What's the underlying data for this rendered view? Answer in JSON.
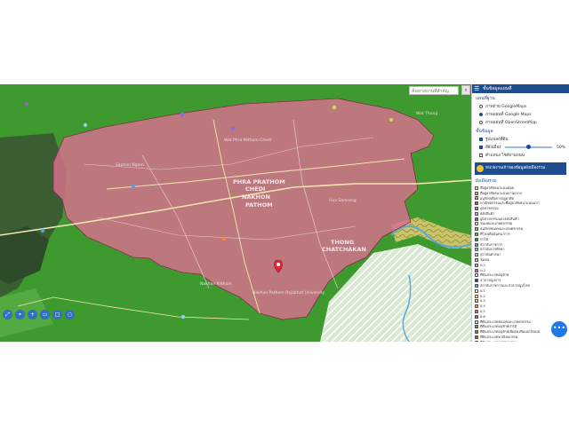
{
  "search": {
    "placeholder": "ค้นหาสถานที่สำคัญ",
    "button_icon": "search-icon"
  },
  "panel": {
    "header": "ชั้นข้อมูลแผนที่",
    "basemap_title": "แผนที่ฐาน",
    "basemaps": [
      {
        "label": "ภาพถ่าย GoogleMaps",
        "selected": false
      },
      {
        "label": "ภาพแผนที่ Google Maps",
        "selected": true
      },
      {
        "label": "ภาพแผนที่ OpenStreetMap",
        "selected": false
      }
    ],
    "layers_title": "ชั้นข้อมูล",
    "layers": [
      {
        "label": "รูปแปลงที่ดิน",
        "checked": true
      },
      {
        "label": "สีผังเมือง",
        "checked": true,
        "opacity_label": "50%",
        "opacity": 0.5
      },
      {
        "label": "ตำแหน่ง ไซท์งานถนน",
        "checked": false
      }
    ],
    "agency": "หน่วยงานเจ้าของข้อมูลผังเมืองรวม",
    "legend_title": "ผังเมืองรวม",
    "legend": [
      {
        "label": "ที่อยู่อาศัยหนาแน่นน้อย",
        "color": "#f7e35a"
      },
      {
        "label": "ที่อยู่อาศัยหนาแน่นปานกลาง",
        "color": "#f2a23a"
      },
      {
        "label": "อนุรักษ์เพื่อการอยู่อาศัย",
        "color": "#c8a06a"
      },
      {
        "label": "พาณิชยกรรมและที่อยู่อาศัยหนาแน่นมาก",
        "color": "#e8324a"
      },
      {
        "label": "อุตสาหกรรม",
        "color": "#b06ad8"
      },
      {
        "label": "คลังสินค้า",
        "color": "#d3a6e8"
      },
      {
        "label": "อุตสาหกรรมและคลังสินค้า",
        "color": "#9b4fb8"
      },
      {
        "label": "ชนบทและเกษตรกรรม",
        "color": "#e7f1c8"
      },
      {
        "label": "อนุรักษ์ชนบทและเกษตรกรรม",
        "color": "#7ec46b"
      },
      {
        "label": "ที่โล่งเพื่อนันทนาการ",
        "color": "#5ab34f"
      },
      {
        "label": "ป่าไม้",
        "color": "#2f8f3a"
      },
      {
        "label": "สถาบันราชการ",
        "color": "#4ba7e8"
      },
      {
        "label": "สถาบันการศึกษา",
        "color": "#7cc7ef"
      },
      {
        "label": "สถาบันศาสนา",
        "color": "#c9c9c9"
      },
      {
        "label": "ชุมชน",
        "color": "#e5a0b8"
      },
      {
        "label": "พ.1",
        "color": "#f38cb0"
      },
      {
        "label": "พ.2",
        "color": "#e05a90"
      },
      {
        "label": "ที่ดินประเภทอนุรักษ์",
        "color": "#ffffff"
      },
      {
        "label": "สาธารณูปการ",
        "color": "#1e3c8a"
      },
      {
        "label": "สถาบันราชการและสาธารณูปโภค",
        "color": "#6aa9ff"
      },
      {
        "label": "ย.1",
        "color": "#fff3a0"
      },
      {
        "label": "ย.2",
        "color": "#ffe170"
      },
      {
        "label": "ย.3",
        "color": "#f6c04a"
      },
      {
        "label": "ย.4",
        "color": "#f29b3a"
      },
      {
        "label": "ย.5",
        "color": "#ea7a2a"
      },
      {
        "label": "ย.6",
        "color": "#d85a1e"
      },
      {
        "label": "ที่ดินประเภทชนบทและเกษตรกรรม",
        "color": "#d6ecb1"
      },
      {
        "label": "ที่ดินประเภทอนุรักษ์ป่าไม้",
        "color": "#4e9f3d"
      },
      {
        "label": "ที่ดินประเภทอนุรักษ์เพื่อส่งเสริมเอกลักษณ์",
        "color": "#a6783e"
      },
      {
        "label": "ที่ดินประเภทพาณิชยกรรม",
        "color": "#e23c3c"
      },
      {
        "label": "ที่ดินประเภทอุตสาหกรรม",
        "color": "#a65bd6"
      },
      {
        "label": "ที่ดินประเภทคลังสินค้า",
        "color": "#cf9be3"
      },
      {
        "label": "ที่ดินประเภทสถาบันการศึกษา",
        "color": "#9fd3ef"
      },
      {
        "label": "ที่ดินประเภทสถาบันศาสนา",
        "color": "#bdbdbd"
      },
      {
        "label": "ที่ดินประเภทสถาบันราชการ",
        "color": "#3e93de"
      }
    ]
  },
  "map": {
    "labels": [
      {
        "text": "PHRA PRATHOM",
        "kind": "district"
      },
      {
        "text": "CHEDI",
        "kind": "district"
      },
      {
        "text": "NAKHON",
        "kind": "district"
      },
      {
        "text": "PATHOM",
        "kind": "district"
      },
      {
        "text": "THONG",
        "kind": "district"
      },
      {
        "text": "CHATCHAKAN",
        "kind": "district"
      },
      {
        "text": "Wat Phra Pathom Chedi",
        "kind": "poi"
      },
      {
        "text": "Nakhon Pathom",
        "kind": "poi"
      },
      {
        "text": "Wat Thong",
        "kind": "poi"
      },
      {
        "text": "Saphan Ngam",
        "kind": "poi"
      },
      {
        "text": "Hua Samrong",
        "kind": "poi"
      },
      {
        "text": "Nakhon Pathom Rajabhat University",
        "kind": "poi"
      }
    ],
    "marker_icon": "map-pin-icon"
  },
  "tools": [
    {
      "name": "fullscreen",
      "icon": "expand-icon"
    },
    {
      "name": "locate",
      "icon": "pin-icon"
    },
    {
      "name": "zoom-in",
      "icon": "plus-icon"
    },
    {
      "name": "measure",
      "icon": "ruler-icon"
    },
    {
      "name": "draw",
      "icon": "square-icon"
    },
    {
      "name": "circle",
      "icon": "circle-icon"
    },
    {
      "name": "layers",
      "icon": "layers-icon"
    }
  ],
  "fab": {
    "icon": "more-icon",
    "label": "•••"
  }
}
